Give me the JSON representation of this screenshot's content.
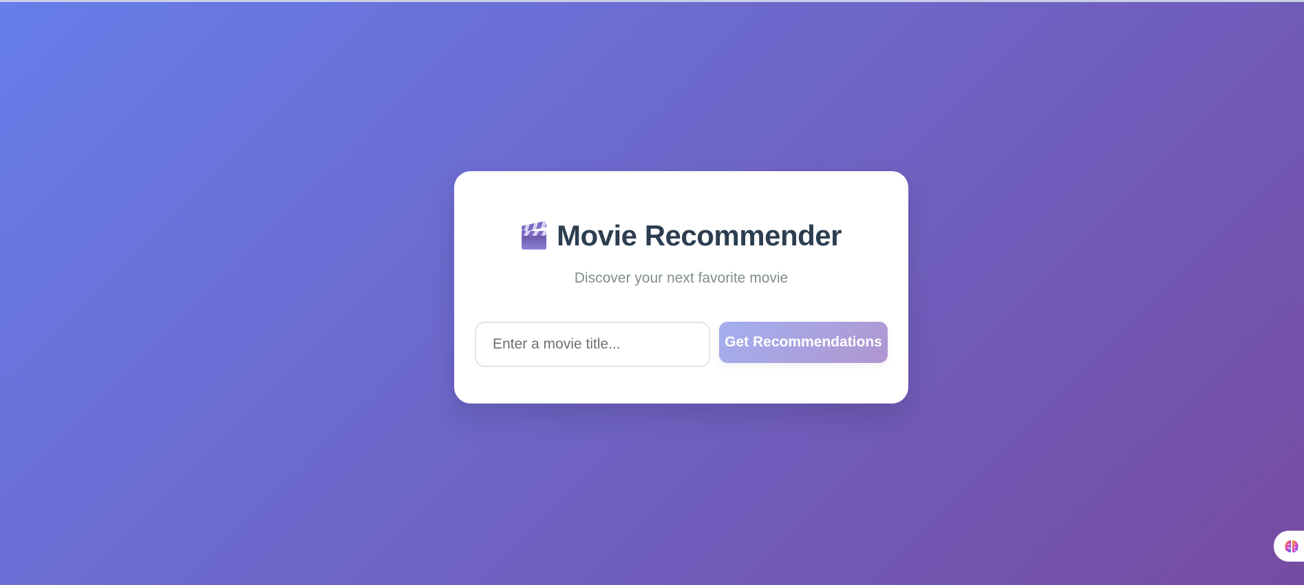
{
  "app": {
    "title": "Movie Recommender",
    "subtitle": "Discover your next favorite movie",
    "title_icon": "clapper-board-icon"
  },
  "search": {
    "placeholder": "Enter a movie title...",
    "value": "",
    "button_label": "Get Recommendations"
  },
  "widget": {
    "icon": "brain-icon"
  },
  "colors": {
    "gradient_start": "#667eea",
    "gradient_end": "#764ba2",
    "title": "#2c3e50",
    "subtitle": "#7f8c8d"
  }
}
